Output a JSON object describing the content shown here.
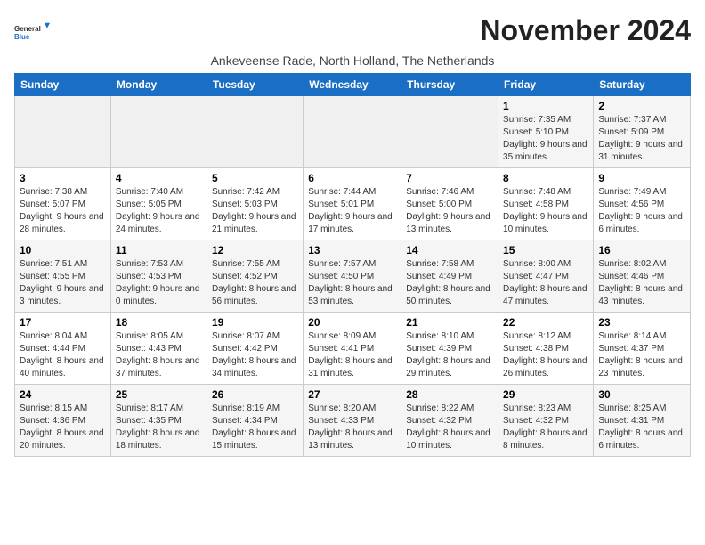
{
  "logo": {
    "general": "General",
    "blue": "Blue"
  },
  "title": "November 2024",
  "location": "Ankeveense Rade, North Holland, The Netherlands",
  "days_of_week": [
    "Sunday",
    "Monday",
    "Tuesday",
    "Wednesday",
    "Thursday",
    "Friday",
    "Saturday"
  ],
  "weeks": [
    [
      {
        "day": "",
        "info": ""
      },
      {
        "day": "",
        "info": ""
      },
      {
        "day": "",
        "info": ""
      },
      {
        "day": "",
        "info": ""
      },
      {
        "day": "",
        "info": ""
      },
      {
        "day": "1",
        "info": "Sunrise: 7:35 AM\nSunset: 5:10 PM\nDaylight: 9 hours and 35 minutes."
      },
      {
        "day": "2",
        "info": "Sunrise: 7:37 AM\nSunset: 5:09 PM\nDaylight: 9 hours and 31 minutes."
      }
    ],
    [
      {
        "day": "3",
        "info": "Sunrise: 7:38 AM\nSunset: 5:07 PM\nDaylight: 9 hours and 28 minutes."
      },
      {
        "day": "4",
        "info": "Sunrise: 7:40 AM\nSunset: 5:05 PM\nDaylight: 9 hours and 24 minutes."
      },
      {
        "day": "5",
        "info": "Sunrise: 7:42 AM\nSunset: 5:03 PM\nDaylight: 9 hours and 21 minutes."
      },
      {
        "day": "6",
        "info": "Sunrise: 7:44 AM\nSunset: 5:01 PM\nDaylight: 9 hours and 17 minutes."
      },
      {
        "day": "7",
        "info": "Sunrise: 7:46 AM\nSunset: 5:00 PM\nDaylight: 9 hours and 13 minutes."
      },
      {
        "day": "8",
        "info": "Sunrise: 7:48 AM\nSunset: 4:58 PM\nDaylight: 9 hours and 10 minutes."
      },
      {
        "day": "9",
        "info": "Sunrise: 7:49 AM\nSunset: 4:56 PM\nDaylight: 9 hours and 6 minutes."
      }
    ],
    [
      {
        "day": "10",
        "info": "Sunrise: 7:51 AM\nSunset: 4:55 PM\nDaylight: 9 hours and 3 minutes."
      },
      {
        "day": "11",
        "info": "Sunrise: 7:53 AM\nSunset: 4:53 PM\nDaylight: 9 hours and 0 minutes."
      },
      {
        "day": "12",
        "info": "Sunrise: 7:55 AM\nSunset: 4:52 PM\nDaylight: 8 hours and 56 minutes."
      },
      {
        "day": "13",
        "info": "Sunrise: 7:57 AM\nSunset: 4:50 PM\nDaylight: 8 hours and 53 minutes."
      },
      {
        "day": "14",
        "info": "Sunrise: 7:58 AM\nSunset: 4:49 PM\nDaylight: 8 hours and 50 minutes."
      },
      {
        "day": "15",
        "info": "Sunrise: 8:00 AM\nSunset: 4:47 PM\nDaylight: 8 hours and 47 minutes."
      },
      {
        "day": "16",
        "info": "Sunrise: 8:02 AM\nSunset: 4:46 PM\nDaylight: 8 hours and 43 minutes."
      }
    ],
    [
      {
        "day": "17",
        "info": "Sunrise: 8:04 AM\nSunset: 4:44 PM\nDaylight: 8 hours and 40 minutes."
      },
      {
        "day": "18",
        "info": "Sunrise: 8:05 AM\nSunset: 4:43 PM\nDaylight: 8 hours and 37 minutes."
      },
      {
        "day": "19",
        "info": "Sunrise: 8:07 AM\nSunset: 4:42 PM\nDaylight: 8 hours and 34 minutes."
      },
      {
        "day": "20",
        "info": "Sunrise: 8:09 AM\nSunset: 4:41 PM\nDaylight: 8 hours and 31 minutes."
      },
      {
        "day": "21",
        "info": "Sunrise: 8:10 AM\nSunset: 4:39 PM\nDaylight: 8 hours and 29 minutes."
      },
      {
        "day": "22",
        "info": "Sunrise: 8:12 AM\nSunset: 4:38 PM\nDaylight: 8 hours and 26 minutes."
      },
      {
        "day": "23",
        "info": "Sunrise: 8:14 AM\nSunset: 4:37 PM\nDaylight: 8 hours and 23 minutes."
      }
    ],
    [
      {
        "day": "24",
        "info": "Sunrise: 8:15 AM\nSunset: 4:36 PM\nDaylight: 8 hours and 20 minutes."
      },
      {
        "day": "25",
        "info": "Sunrise: 8:17 AM\nSunset: 4:35 PM\nDaylight: 8 hours and 18 minutes."
      },
      {
        "day": "26",
        "info": "Sunrise: 8:19 AM\nSunset: 4:34 PM\nDaylight: 8 hours and 15 minutes."
      },
      {
        "day": "27",
        "info": "Sunrise: 8:20 AM\nSunset: 4:33 PM\nDaylight: 8 hours and 13 minutes."
      },
      {
        "day": "28",
        "info": "Sunrise: 8:22 AM\nSunset: 4:32 PM\nDaylight: 8 hours and 10 minutes."
      },
      {
        "day": "29",
        "info": "Sunrise: 8:23 AM\nSunset: 4:32 PM\nDaylight: 8 hours and 8 minutes."
      },
      {
        "day": "30",
        "info": "Sunrise: 8:25 AM\nSunset: 4:31 PM\nDaylight: 8 hours and 6 minutes."
      }
    ]
  ]
}
